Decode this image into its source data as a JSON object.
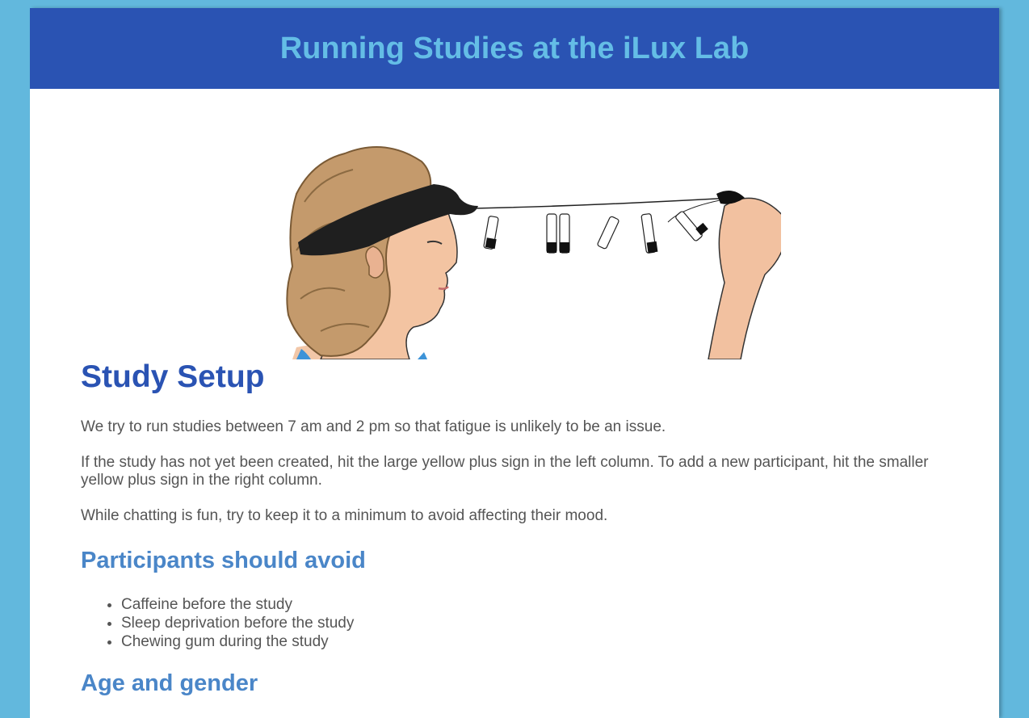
{
  "header": {
    "title": "Running Studies at the iLux Lab"
  },
  "hero": {
    "icon": "eeg-headset-illustration"
  },
  "study_setup": {
    "heading": "Study Setup",
    "paragraphs": [
      "We try to run studies between 7 am and 2 pm so that fatigue is unlikely to be an issue.",
      "If the study has not yet been created, hit the large yellow plus sign in the left column. To add a new participant, hit the smaller yellow plus sign in the right column.",
      "While chatting is fun, try to keep it to a minimum to avoid affecting their mood."
    ]
  },
  "avoid": {
    "heading": "Participants should avoid",
    "items": [
      "Caffeine before the study",
      "Sleep deprivation before the study",
      "Chewing gum during the study"
    ]
  },
  "age_gender": {
    "heading": "Age and gender"
  },
  "colors": {
    "background": "#62b8dd",
    "header_bg": "#2a53b3",
    "header_text": "#64bde6",
    "heading_primary": "#2a53b3",
    "heading_secondary": "#4a86c8",
    "body_text": "#555555"
  }
}
